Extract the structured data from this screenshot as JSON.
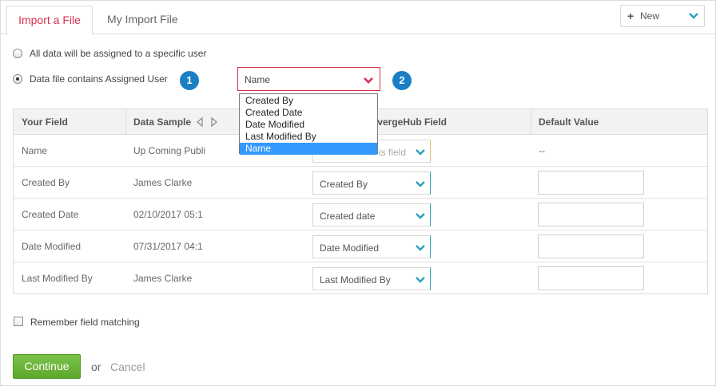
{
  "tabs": [
    {
      "label": "Import a File",
      "active": true
    },
    {
      "label": "My Import File",
      "active": false
    }
  ],
  "new_button": {
    "label": "New",
    "icon": "plus-icon"
  },
  "assignment": {
    "option_specific_user": "All data will be assigned to a specific user",
    "option_data_file": "Data file contains Assigned User",
    "selected": "option_data_file"
  },
  "badges": [
    "1",
    "2"
  ],
  "assigned_user_select": {
    "value": "Name",
    "options": [
      "Created By",
      "Created Date",
      "Date Modified",
      "Last Modified By",
      "Name"
    ],
    "highlighted": "Name"
  },
  "table": {
    "headers": {
      "your_field": "Your Field",
      "data_sample": "Data Sample",
      "cloud_field": "nvergeHub Field",
      "default_value": "Default Value"
    },
    "rows": [
      {
        "field": "Name",
        "sample": "Up Coming Publi",
        "mapped": "is field",
        "placeholder": true,
        "default": "--"
      },
      {
        "field": "Created By",
        "sample": "James Clarke",
        "mapped": "Created By",
        "placeholder": false,
        "default": ""
      },
      {
        "field": "Created Date",
        "sample": "02/10/2017 05:1",
        "mapped": "Created date",
        "placeholder": false,
        "default": ""
      },
      {
        "field": "Date Modified",
        "sample": "07/31/2017 04:1",
        "mapped": "Date Modified",
        "placeholder": false,
        "default": ""
      },
      {
        "field": "Last Modified By",
        "sample": "James Clarke",
        "mapped": "Last Modified By",
        "placeholder": false,
        "default": ""
      }
    ]
  },
  "remember_label": "Remember field matching",
  "continue_label": "Continue",
  "or_label": "or",
  "cancel_label": "Cancel",
  "colors": {
    "accent_red": "#d9304f",
    "badge_blue": "#1a7fc4",
    "teal": "#2aa3b8",
    "continue_green": "#5ca82c",
    "dropdown_highlight": "#3399ff"
  }
}
